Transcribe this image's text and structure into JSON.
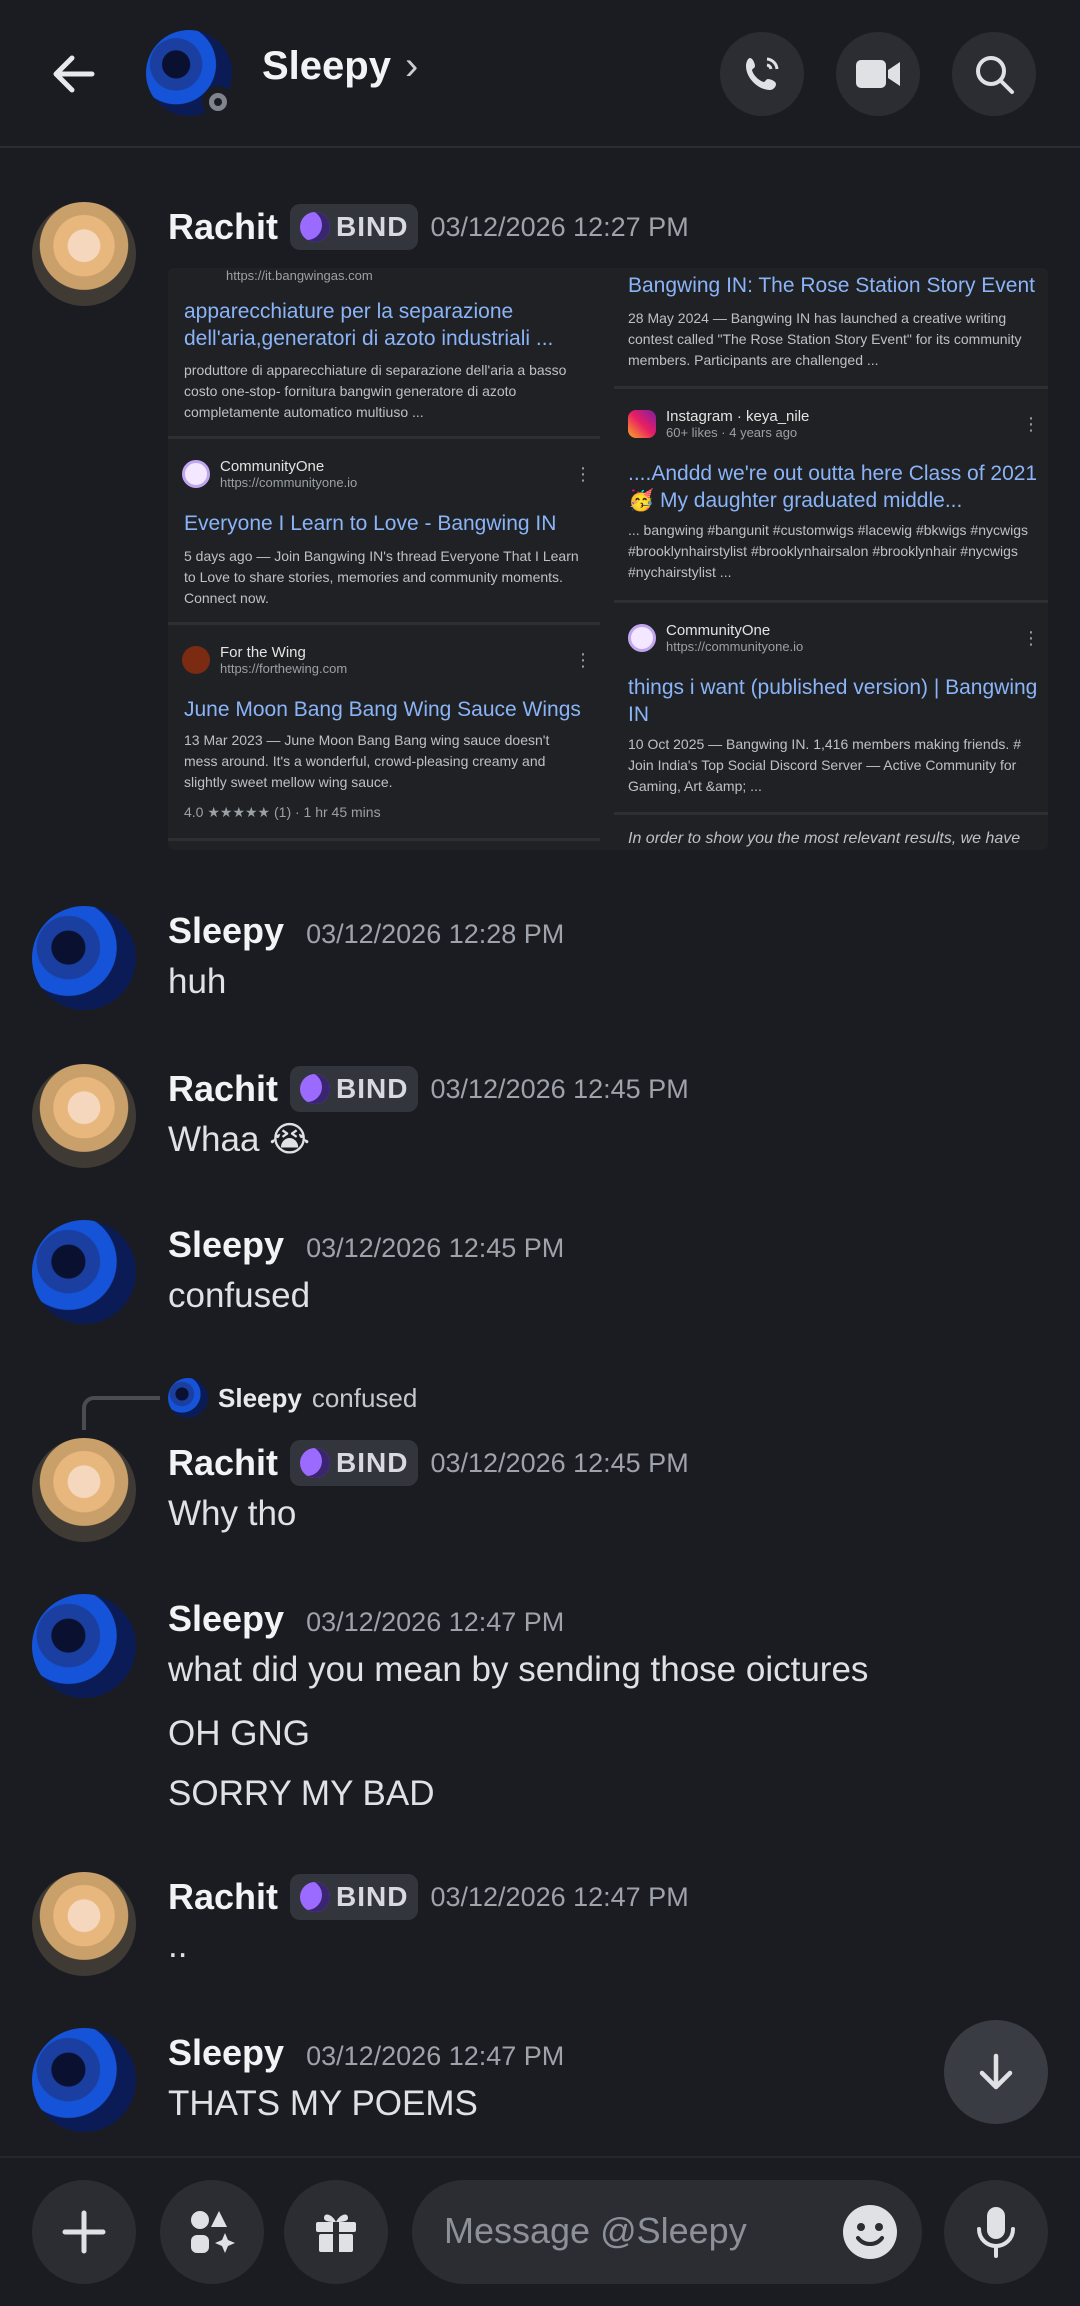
{
  "header": {
    "title": "Sleepy",
    "chevron": "›"
  },
  "badge_text": "BIND",
  "search_shot": {
    "left": [
      {
        "url": "https://it.bangwingas.com",
        "title": "apparecchiature per la separazione dell'aria,generatori di azoto industriali ...",
        "snippet": "produttore di apparecchiature di separazione dell'aria a basso costo one-stop- fornitura bangwin generatore di azoto completamente automatico multiuso ..."
      },
      {
        "source": "CommunityOne",
        "url": "https://communityone.io",
        "title": "Everyone I Learn to Love - Bangwing IN",
        "snippet": "5 days ago — Join Bangwing IN's thread Everyone That I Learn to Love to share stories, memories and community moments. Connect now."
      },
      {
        "source": "For the Wing",
        "url": "https://forthewing.com",
        "title": "June Moon Bang Bang Wing Sauce Wings",
        "snippet": "13 Mar 2023 — June Moon Bang Bang wing sauce doesn't mess around. It's a wonderful, crowd-pleasing creamy and slightly sweet mellow wing sauce.",
        "rating": "4.0 ★★★★★ (1) · 1 hr 45 mins"
      }
    ],
    "right": [
      {
        "title": "Bangwing IN: The Rose Station Story Event",
        "snippet": "28 May 2024 — Bangwing IN has launched a creative writing contest called \"The Rose Station Story Event\" for its community members. Participants are challenged ..."
      },
      {
        "source": "Instagram · keya_nile",
        "url": "60+ likes · 4 years ago",
        "title": "....Anddd we're out outta here Class of 2021🥳 My daughter graduated middle...",
        "snippet": "... bangwing #bangunit #customwigs #lacewig #bkwigs #nycwigs #brooklynhairstylist #brooklynhairsalon #brooklynhair #nycwigs #nychairstylist ..."
      },
      {
        "source": "CommunityOne",
        "url": "https://communityone.io",
        "title": "things i want (published version) | Bangwing IN",
        "snippet": "10 Oct 2025 — Bangwing IN. 1,416 members making friends. # Join India's Top Social Discord Server — Active Community for Gaming, Art &amp; ..."
      }
    ],
    "footer": "In order to show you the most relevant results, we have"
  },
  "messages": [
    {
      "author": "Rachit",
      "time": "03/12/2026 12:27 PM"
    },
    {
      "author": "Sleepy",
      "time": "03/12/2026 12:28 PM",
      "text": "huh"
    },
    {
      "author": "Rachit",
      "time": "03/12/2026 12:45 PM",
      "text": "Whaa 😭"
    },
    {
      "author": "Sleepy",
      "time": "03/12/2026 12:45 PM",
      "text": "confused"
    },
    {
      "author": "Rachit",
      "time": "03/12/2026 12:45 PM",
      "text": "Why tho",
      "reply": {
        "author": "Sleepy",
        "text": "confused"
      }
    },
    {
      "author": "Sleepy",
      "time": "03/12/2026 12:47 PM",
      "text": "what did you mean by sending those oictures",
      "text2": "OH GNG",
      "text3": "SORRY MY BAD"
    },
    {
      "author": "Rachit",
      "time": "03/12/2026 12:47 PM",
      "text": ".."
    },
    {
      "author": "Sleepy",
      "time": "03/12/2026 12:47 PM",
      "text": "THATS MY POEMS"
    }
  ],
  "composer": {
    "placeholder": "Message @Sleepy"
  },
  "icons": [
    "back-arrow-icon",
    "phone-icon",
    "video-icon",
    "search-icon",
    "plus-icon",
    "apps-icon",
    "gift-icon",
    "emoji-icon",
    "mic-icon",
    "arrow-down-icon"
  ]
}
